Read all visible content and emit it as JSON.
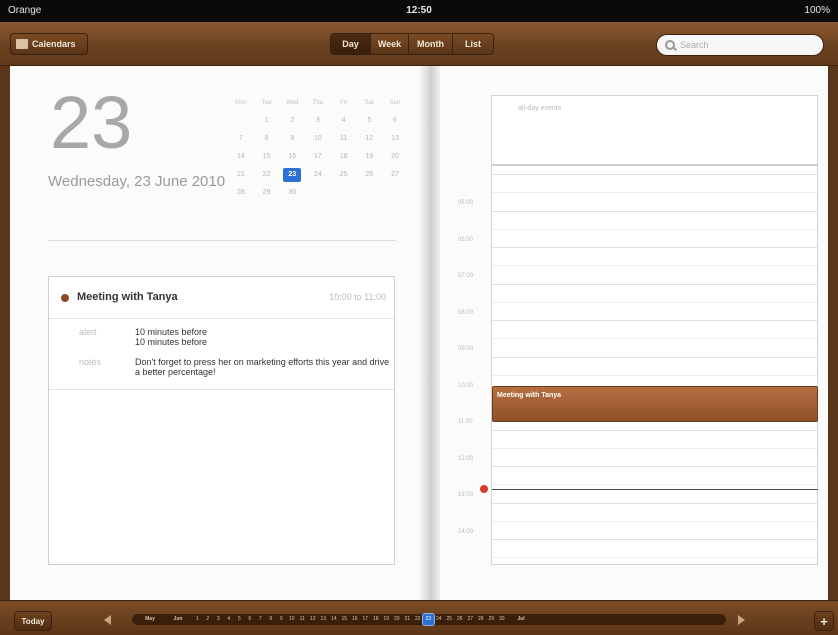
{
  "status_bar": {
    "carrier": "Orange",
    "time": "12:50",
    "battery": "100%"
  },
  "toolbar": {
    "calendars_label": "Calendars",
    "tabs": [
      {
        "label": "Day",
        "active": true
      },
      {
        "label": "Week",
        "active": false
      },
      {
        "label": "Month",
        "active": false
      },
      {
        "label": "List",
        "active": false
      }
    ],
    "search_placeholder": "Search"
  },
  "day_view": {
    "day_number": "23",
    "long_date": "Wednesday, 23 June 2010",
    "mini_calendar": {
      "weekdays": [
        "Mon",
        "Tue",
        "Wed",
        "Thu",
        "Fri",
        "Sat",
        "Sun"
      ],
      "weeks": [
        [
          "",
          "1",
          "2",
          "3",
          "4",
          "5",
          "6"
        ],
        [
          "7",
          "8",
          "9",
          "10",
          "11",
          "12",
          "13"
        ],
        [
          "14",
          "15",
          "16",
          "17",
          "18",
          "19",
          "20"
        ],
        [
          "21",
          "22",
          "23",
          "24",
          "25",
          "26",
          "27"
        ],
        [
          "28",
          "29",
          "30",
          "",
          "",
          "",
          ""
        ]
      ],
      "selected": "23"
    },
    "event": {
      "title": "Meeting with Tanya",
      "time": "10:00 to 11:00",
      "alert_label": "alert",
      "alert_1": "10 minutes before",
      "alert_2": "10 minutes before",
      "notes_label": "notes",
      "notes": "Don't forget to press her on marketing efforts this year and drive a better percentage!",
      "color": "#8a4a26"
    },
    "all_day_label": "all-day events",
    "hours": [
      "05:00",
      "06:00",
      "07:00",
      "08:00",
      "09:00",
      "10:00",
      "11:00",
      "12:00",
      "13:00",
      "14:00"
    ],
    "grid_event_title": "Meeting with Tanya"
  },
  "bottom_bar": {
    "today_label": "Today",
    "strip": [
      "May",
      "Jun",
      "1",
      "2",
      "3",
      "4",
      "5",
      "6",
      "7",
      "8",
      "9",
      "10",
      "11",
      "12",
      "13",
      "14",
      "15",
      "16",
      "17",
      "18",
      "19",
      "20",
      "21",
      "22",
      "23",
      "24",
      "25",
      "26",
      "27",
      "28",
      "29",
      "30",
      "Jul"
    ],
    "selected_day": "23",
    "add_label": "+"
  }
}
